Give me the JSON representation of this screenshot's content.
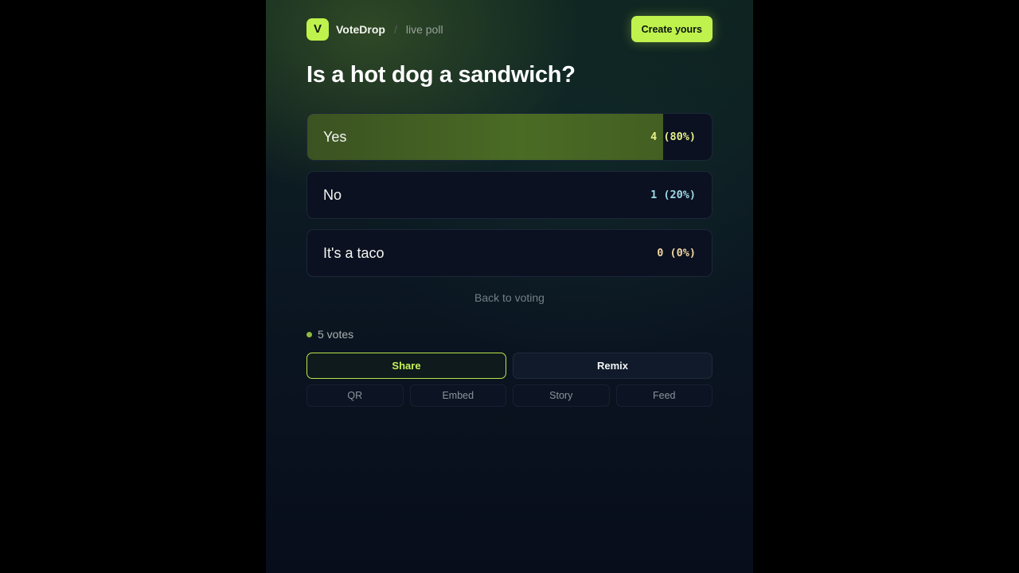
{
  "header": {
    "logo_letter": "V",
    "brand": "VoteDrop",
    "separator": "/",
    "subtitle": "live poll",
    "create_label": "Create yours"
  },
  "poll": {
    "question": "Is a hot dog a sandwich?",
    "options": [
      {
        "label": "Yes",
        "votes": 4,
        "percent": 80,
        "count_text": "4 (80%)",
        "count_color": "#e6f08a"
      },
      {
        "label": "No",
        "votes": 1,
        "percent": 20,
        "count_text": "1 (20%)",
        "count_color": "#9fd8e8"
      },
      {
        "label": "It's a taco",
        "votes": 0,
        "percent": 0,
        "count_text": "0 (0%)",
        "count_color": "#f3d6a2"
      }
    ],
    "back_label": "Back to voting",
    "votes_label": "5 votes"
  },
  "actions": {
    "share": "Share",
    "remix": "Remix",
    "mini": [
      "QR",
      "Embed",
      "Story",
      "Feed"
    ]
  },
  "colors": {
    "accent": "#bff24c",
    "winner_fill": "#4a6b24",
    "background": "#0b1722"
  }
}
